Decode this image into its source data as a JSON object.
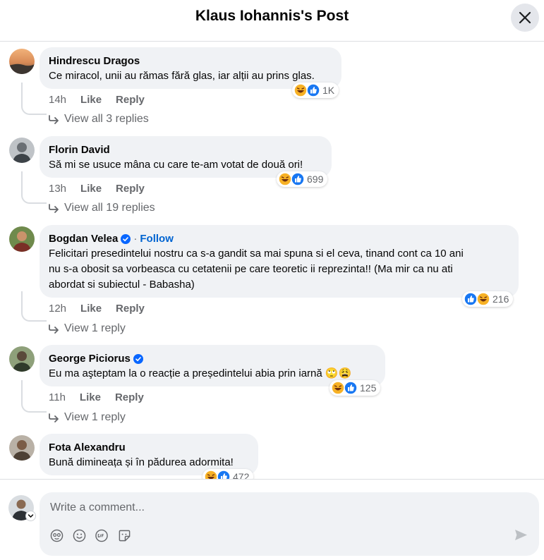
{
  "header": {
    "title": "Klaus Iohannis's Post"
  },
  "comments": [
    {
      "author": "Hindrescu Dragos",
      "text": "Ce miracol, unii au rămas fără glas, iar alții au prins glas.",
      "time": "14h",
      "like": "Like",
      "reply": "Reply",
      "reaction_count": "1K",
      "replies": "View all 3 replies"
    },
    {
      "author": "Florin David",
      "text": "Să mi se usuce mâna cu care te-am votat de două ori!",
      "time": "13h",
      "like": "Like",
      "reply": "Reply",
      "reaction_count": "699",
      "replies": "View all 19 replies"
    },
    {
      "author": "Bogdan Velea",
      "follow_sep": "·",
      "follow": "Follow",
      "text_lines": [
        "Felicitari presedintelui nostru ca s-a gandit sa mai spuna si el ceva, tinand cont ca 10 ani",
        "nu s-a obosit sa vorbeasca cu cetatenii pe care teoretic ii reprezinta!! (Ma mir ca nu ati",
        "abordat si subiectul - Babasha)"
      ],
      "time": "12h",
      "like": "Like",
      "reply": "Reply",
      "reaction_count": "216",
      "replies": "View 1 reply"
    },
    {
      "author": "George Piciorus",
      "text": "Eu ma aşteptam la o reacție a președintelui abia prin iarnă",
      "emoji": "🙄😩",
      "time": "11h",
      "like": "Like",
      "reply": "Reply",
      "reaction_count": "125",
      "replies": "View 1 reply"
    },
    {
      "author": "Fota Alexandru",
      "text": "Bună dimineața și în pădurea adormita!",
      "reaction_count": "472"
    }
  ],
  "composer": {
    "placeholder": "Write a comment..."
  },
  "colors": {
    "accent": "#0866ff",
    "bubble": "#f0f2f5",
    "muted": "#65676b",
    "verified": "#0866ff"
  }
}
